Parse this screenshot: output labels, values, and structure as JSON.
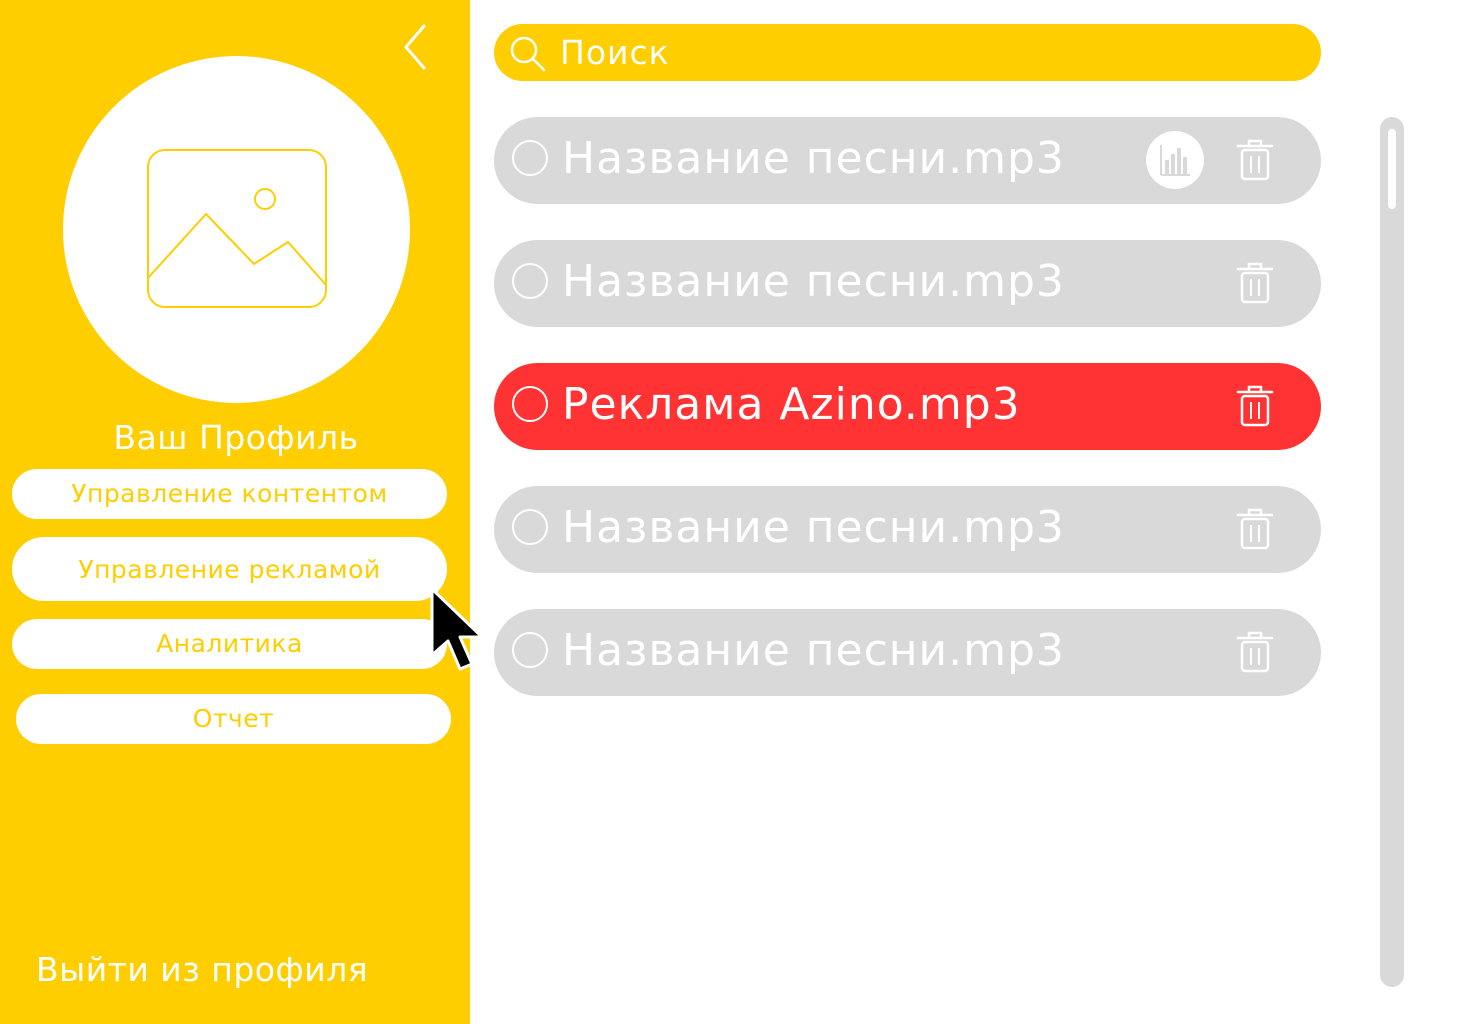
{
  "sidebar": {
    "back_icon": "chevron-left-icon",
    "avatar_icon": "image-placeholder-icon",
    "profile_title": "Ваш Профиль",
    "menu": {
      "content": "Управление контентом",
      "ads": "Управление рекламой",
      "analytics": "Аналитика",
      "report": "Отчет"
    },
    "logout": "Выйти из профиля"
  },
  "search": {
    "placeholder": "Поиск",
    "icon": "search-icon"
  },
  "tracks": [
    {
      "name": "Название песни.mp3",
      "highlighted": false,
      "has_stats": true
    },
    {
      "name": "Название песни.mp3",
      "highlighted": false,
      "has_stats": false
    },
    {
      "name": "Реклама Azino.mp3",
      "highlighted": true,
      "has_stats": false
    },
    {
      "name": "Название песни.mp3",
      "highlighted": false,
      "has_stats": false
    },
    {
      "name": "Название песни.mp3",
      "highlighted": false,
      "has_stats": false
    }
  ],
  "colors": {
    "accent": "#FFCE00",
    "highlight": "#FF3333",
    "row": "#D9D9D9",
    "text_light": "#FFFFFF"
  }
}
